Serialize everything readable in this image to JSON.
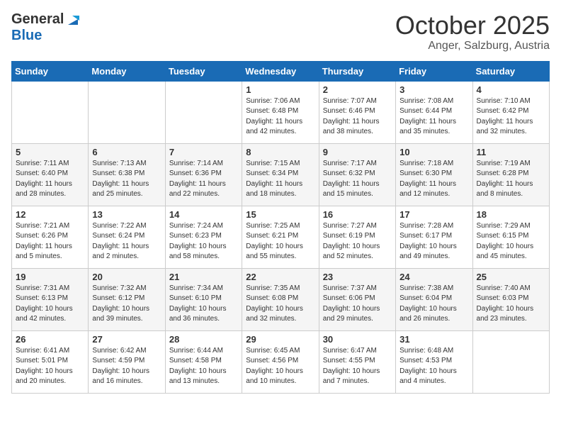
{
  "header": {
    "logo_general": "General",
    "logo_blue": "Blue",
    "month_title": "October 2025",
    "location": "Anger, Salzburg, Austria"
  },
  "days_of_week": [
    "Sunday",
    "Monday",
    "Tuesday",
    "Wednesday",
    "Thursday",
    "Friday",
    "Saturday"
  ],
  "weeks": [
    [
      {
        "day": "",
        "sunrise": "",
        "sunset": "",
        "daylight": ""
      },
      {
        "day": "",
        "sunrise": "",
        "sunset": "",
        "daylight": ""
      },
      {
        "day": "",
        "sunrise": "",
        "sunset": "",
        "daylight": ""
      },
      {
        "day": "1",
        "sunrise": "Sunrise: 7:06 AM",
        "sunset": "Sunset: 6:48 PM",
        "daylight": "Daylight: 11 hours and 42 minutes."
      },
      {
        "day": "2",
        "sunrise": "Sunrise: 7:07 AM",
        "sunset": "Sunset: 6:46 PM",
        "daylight": "Daylight: 11 hours and 38 minutes."
      },
      {
        "day": "3",
        "sunrise": "Sunrise: 7:08 AM",
        "sunset": "Sunset: 6:44 PM",
        "daylight": "Daylight: 11 hours and 35 minutes."
      },
      {
        "day": "4",
        "sunrise": "Sunrise: 7:10 AM",
        "sunset": "Sunset: 6:42 PM",
        "daylight": "Daylight: 11 hours and 32 minutes."
      }
    ],
    [
      {
        "day": "5",
        "sunrise": "Sunrise: 7:11 AM",
        "sunset": "Sunset: 6:40 PM",
        "daylight": "Daylight: 11 hours and 28 minutes."
      },
      {
        "day": "6",
        "sunrise": "Sunrise: 7:13 AM",
        "sunset": "Sunset: 6:38 PM",
        "daylight": "Daylight: 11 hours and 25 minutes."
      },
      {
        "day": "7",
        "sunrise": "Sunrise: 7:14 AM",
        "sunset": "Sunset: 6:36 PM",
        "daylight": "Daylight: 11 hours and 22 minutes."
      },
      {
        "day": "8",
        "sunrise": "Sunrise: 7:15 AM",
        "sunset": "Sunset: 6:34 PM",
        "daylight": "Daylight: 11 hours and 18 minutes."
      },
      {
        "day": "9",
        "sunrise": "Sunrise: 7:17 AM",
        "sunset": "Sunset: 6:32 PM",
        "daylight": "Daylight: 11 hours and 15 minutes."
      },
      {
        "day": "10",
        "sunrise": "Sunrise: 7:18 AM",
        "sunset": "Sunset: 6:30 PM",
        "daylight": "Daylight: 11 hours and 12 minutes."
      },
      {
        "day": "11",
        "sunrise": "Sunrise: 7:19 AM",
        "sunset": "Sunset: 6:28 PM",
        "daylight": "Daylight: 11 hours and 8 minutes."
      }
    ],
    [
      {
        "day": "12",
        "sunrise": "Sunrise: 7:21 AM",
        "sunset": "Sunset: 6:26 PM",
        "daylight": "Daylight: 11 hours and 5 minutes."
      },
      {
        "day": "13",
        "sunrise": "Sunrise: 7:22 AM",
        "sunset": "Sunset: 6:24 PM",
        "daylight": "Daylight: 11 hours and 2 minutes."
      },
      {
        "day": "14",
        "sunrise": "Sunrise: 7:24 AM",
        "sunset": "Sunset: 6:23 PM",
        "daylight": "Daylight: 10 hours and 58 minutes."
      },
      {
        "day": "15",
        "sunrise": "Sunrise: 7:25 AM",
        "sunset": "Sunset: 6:21 PM",
        "daylight": "Daylight: 10 hours and 55 minutes."
      },
      {
        "day": "16",
        "sunrise": "Sunrise: 7:27 AM",
        "sunset": "Sunset: 6:19 PM",
        "daylight": "Daylight: 10 hours and 52 minutes."
      },
      {
        "day": "17",
        "sunrise": "Sunrise: 7:28 AM",
        "sunset": "Sunset: 6:17 PM",
        "daylight": "Daylight: 10 hours and 49 minutes."
      },
      {
        "day": "18",
        "sunrise": "Sunrise: 7:29 AM",
        "sunset": "Sunset: 6:15 PM",
        "daylight": "Daylight: 10 hours and 45 minutes."
      }
    ],
    [
      {
        "day": "19",
        "sunrise": "Sunrise: 7:31 AM",
        "sunset": "Sunset: 6:13 PM",
        "daylight": "Daylight: 10 hours and 42 minutes."
      },
      {
        "day": "20",
        "sunrise": "Sunrise: 7:32 AM",
        "sunset": "Sunset: 6:12 PM",
        "daylight": "Daylight: 10 hours and 39 minutes."
      },
      {
        "day": "21",
        "sunrise": "Sunrise: 7:34 AM",
        "sunset": "Sunset: 6:10 PM",
        "daylight": "Daylight: 10 hours and 36 minutes."
      },
      {
        "day": "22",
        "sunrise": "Sunrise: 7:35 AM",
        "sunset": "Sunset: 6:08 PM",
        "daylight": "Daylight: 10 hours and 32 minutes."
      },
      {
        "day": "23",
        "sunrise": "Sunrise: 7:37 AM",
        "sunset": "Sunset: 6:06 PM",
        "daylight": "Daylight: 10 hours and 29 minutes."
      },
      {
        "day": "24",
        "sunrise": "Sunrise: 7:38 AM",
        "sunset": "Sunset: 6:04 PM",
        "daylight": "Daylight: 10 hours and 26 minutes."
      },
      {
        "day": "25",
        "sunrise": "Sunrise: 7:40 AM",
        "sunset": "Sunset: 6:03 PM",
        "daylight": "Daylight: 10 hours and 23 minutes."
      }
    ],
    [
      {
        "day": "26",
        "sunrise": "Sunrise: 6:41 AM",
        "sunset": "Sunset: 5:01 PM",
        "daylight": "Daylight: 10 hours and 20 minutes."
      },
      {
        "day": "27",
        "sunrise": "Sunrise: 6:42 AM",
        "sunset": "Sunset: 4:59 PM",
        "daylight": "Daylight: 10 hours and 16 minutes."
      },
      {
        "day": "28",
        "sunrise": "Sunrise: 6:44 AM",
        "sunset": "Sunset: 4:58 PM",
        "daylight": "Daylight: 10 hours and 13 minutes."
      },
      {
        "day": "29",
        "sunrise": "Sunrise: 6:45 AM",
        "sunset": "Sunset: 4:56 PM",
        "daylight": "Daylight: 10 hours and 10 minutes."
      },
      {
        "day": "30",
        "sunrise": "Sunrise: 6:47 AM",
        "sunset": "Sunset: 4:55 PM",
        "daylight": "Daylight: 10 hours and 7 minutes."
      },
      {
        "day": "31",
        "sunrise": "Sunrise: 6:48 AM",
        "sunset": "Sunset: 4:53 PM",
        "daylight": "Daylight: 10 hours and 4 minutes."
      },
      {
        "day": "",
        "sunrise": "",
        "sunset": "",
        "daylight": ""
      }
    ]
  ]
}
